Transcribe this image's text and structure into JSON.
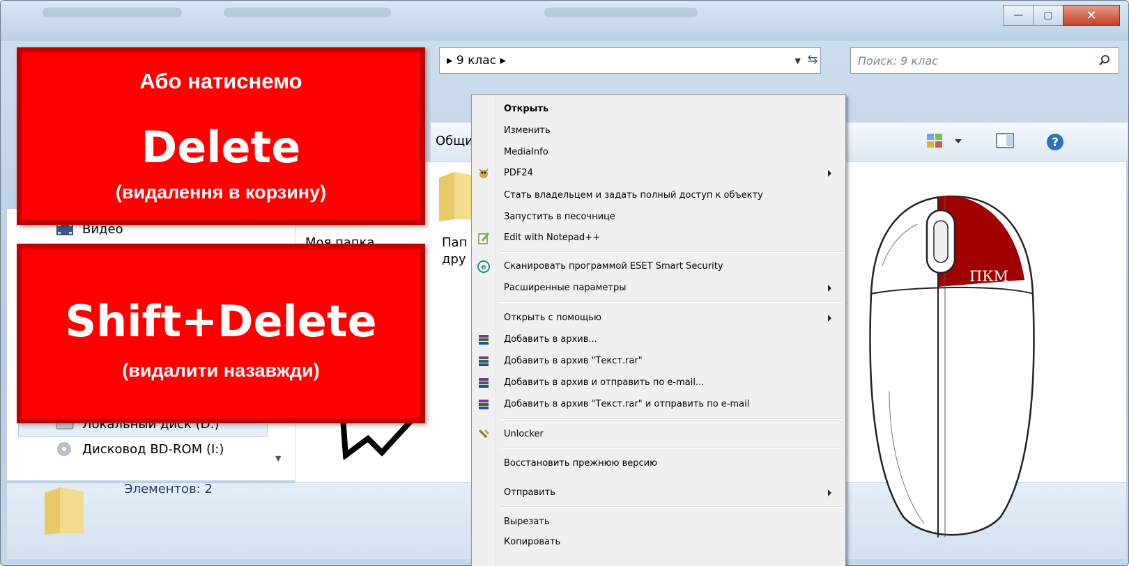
{
  "window": {
    "minimize_glyph": "—",
    "maximize_glyph": "▢",
    "close_glyph": "✕"
  },
  "address": {
    "path": "▸ 9 клас ▸",
    "dropdown_glyph": "▼",
    "refresh_glyph": "⇆",
    "search_placeholder": "Поиск: 9 клас"
  },
  "toolbar": {
    "general_partial": "Общий"
  },
  "nav": {
    "items": [
      {
        "label": "Видео",
        "icon": "video-icon"
      },
      {
        "label": "Локальный диск (D:)",
        "icon": "drive-icon"
      },
      {
        "label": "Дисковод BD-ROM (I:)",
        "icon": "disc-icon"
      }
    ]
  },
  "content": {
    "items": [
      {
        "label": "Моя папка"
      },
      {
        "label_line1": "Пап",
        "label_line2": "дру"
      }
    ]
  },
  "status": {
    "text": "Элементов: 2"
  },
  "context_menu": {
    "items": [
      {
        "label": "Открыть",
        "bold": true
      },
      {
        "label": "Изменить"
      },
      {
        "label": "MediaInfo"
      },
      {
        "label": "PDF24",
        "icon": "pdf24-icon",
        "submenu": true
      },
      {
        "label": "Стать владельцем и задать полный доступ к объекту"
      },
      {
        "label": "Запустить в песочнице"
      },
      {
        "label": "Edit with Notepad++",
        "icon": "notepad-icon"
      },
      {
        "label": "Сканировать программой ESET Smart Security",
        "icon": "eset-icon"
      },
      {
        "label": "Расширенные параметры",
        "submenu": true
      },
      {
        "label": "Открыть с помощью",
        "submenu": true
      },
      {
        "label": "Добавить в архив...",
        "icon": "winrar-icon"
      },
      {
        "label": "Добавить в архив \"Текст.rar\"",
        "icon": "winrar-icon"
      },
      {
        "label": "Добавить в архив и отправить по e-mail...",
        "icon": "winrar-icon"
      },
      {
        "label": "Добавить в архив \"Текст.rar\" и отправить по e-mail",
        "icon": "winrar-icon"
      },
      {
        "label": "Unlocker",
        "icon": "unlocker-icon"
      },
      {
        "label": "Восстановить прежнюю версию"
      },
      {
        "label": "Отправить",
        "submenu": true
      },
      {
        "label": "Вырезать"
      },
      {
        "label": "Копировать"
      }
    ]
  },
  "callouts": {
    "delete": {
      "line1": "Або натиснемо",
      "line2": "Delete",
      "line3": "(видалення в корзину)"
    },
    "shift_delete": {
      "line1": "Shift+Delete",
      "line2": "(видалити назавжди)"
    }
  },
  "mouse": {
    "button_label": "ПКМ"
  },
  "colors": {
    "callout_red": "#ff0000",
    "callout_border": "#c00000",
    "mouse_right_button": "#a00000"
  }
}
